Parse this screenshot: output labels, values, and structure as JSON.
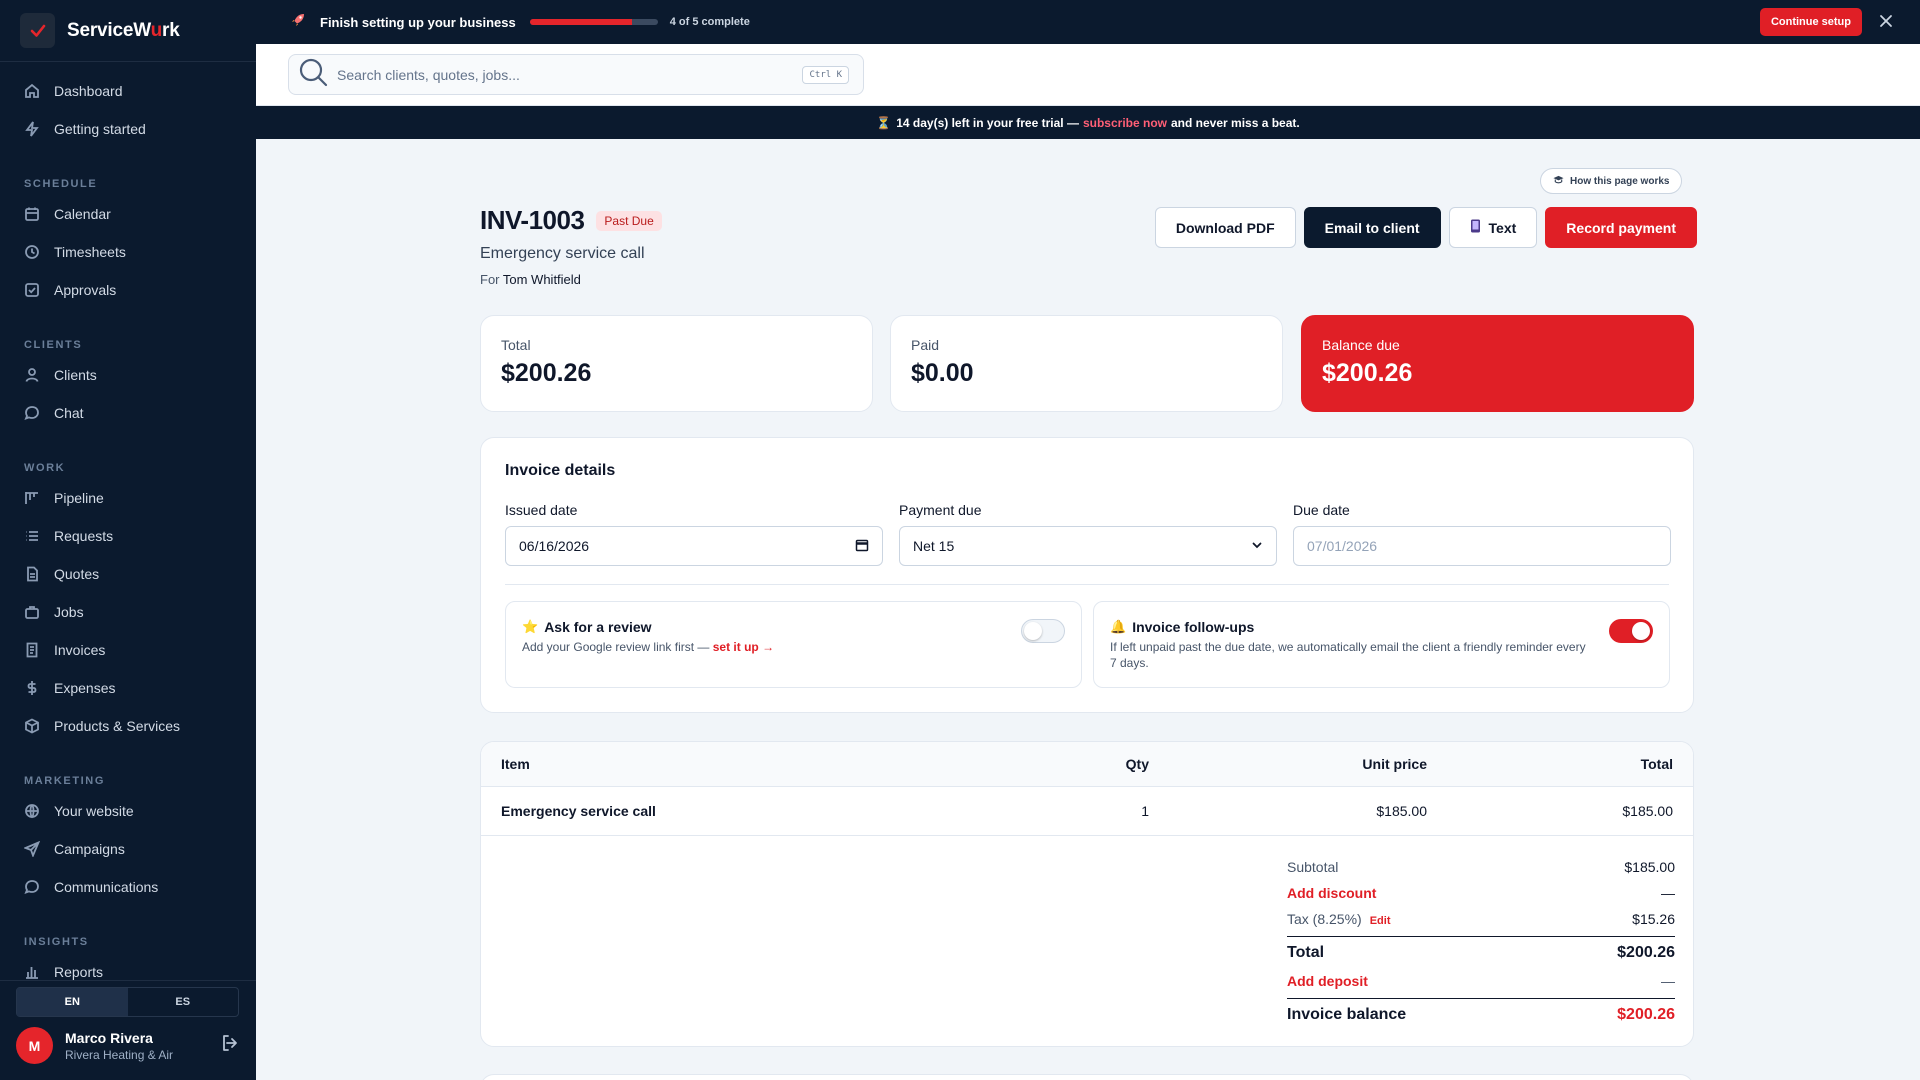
{
  "brand": {
    "prefix": "ServiceW",
    "accent": "u",
    "suffix": "rk"
  },
  "nav": {
    "top": [
      {
        "label": "Dashboard",
        "icon": "home-icon"
      },
      {
        "label": "Getting started",
        "icon": "bolt-icon"
      }
    ],
    "sections": [
      {
        "title": "SCHEDULE",
        "items": [
          {
            "label": "Calendar",
            "icon": "calendar-icon"
          },
          {
            "label": "Timesheets",
            "icon": "clock-icon"
          },
          {
            "label": "Approvals",
            "icon": "check-square-icon"
          }
        ]
      },
      {
        "title": "CLIENTS",
        "items": [
          {
            "label": "Clients",
            "icon": "user-icon"
          },
          {
            "label": "Chat",
            "icon": "chat-icon"
          }
        ]
      },
      {
        "title": "WORK",
        "items": [
          {
            "label": "Pipeline",
            "icon": "kanban-icon"
          },
          {
            "label": "Requests",
            "icon": "list-icon"
          },
          {
            "label": "Quotes",
            "icon": "file-icon"
          },
          {
            "label": "Jobs",
            "icon": "briefcase-icon"
          },
          {
            "label": "Invoices",
            "icon": "invoice-icon"
          },
          {
            "label": "Expenses",
            "icon": "dollar-icon"
          },
          {
            "label": "Products & Services",
            "icon": "box-icon"
          }
        ]
      },
      {
        "title": "MARKETING",
        "items": [
          {
            "label": "Your website",
            "icon": "globe-icon"
          },
          {
            "label": "Campaigns",
            "icon": "send-icon"
          },
          {
            "label": "Communications",
            "icon": "message-icon"
          }
        ]
      },
      {
        "title": "INSIGHTS",
        "items": [
          {
            "label": "Reports",
            "icon": "bar-chart-icon"
          }
        ]
      }
    ]
  },
  "lang": {
    "en": "EN",
    "es": "ES"
  },
  "user": {
    "initial": "M",
    "name": "Marco Rivera",
    "company": "Rivera Heating & Air"
  },
  "setup": {
    "title": "Finish setting up your business",
    "progress": 0.8,
    "count": "4 of 5 complete",
    "cta": "Continue setup"
  },
  "search": {
    "placeholder": "Search clients, quotes, jobs...",
    "shortcut": "Ctrl K"
  },
  "trial": {
    "days": "14",
    "text1": "day(s) left in your free trial —",
    "link": "subscribe now",
    "text2": "and never miss a beat."
  },
  "help": {
    "label": "How this page works"
  },
  "invoice": {
    "number": "INV-1003",
    "status": "Past Due",
    "subject": "Emergency service call",
    "for_label": "For",
    "client": "Tom Whitfield"
  },
  "actions": {
    "download": "Download PDF",
    "email": "Email to client",
    "text": "Text",
    "record": "Record payment"
  },
  "stats": {
    "total": {
      "label": "Total",
      "value": "$200.26"
    },
    "paid": {
      "label": "Paid",
      "value": "$0.00"
    },
    "balance": {
      "label": "Balance due",
      "value": "$200.26"
    }
  },
  "details": {
    "title": "Invoice details",
    "issued": {
      "label": "Issued date",
      "value": "06/16/2026"
    },
    "payment": {
      "label": "Payment due",
      "value": "Net 15"
    },
    "due": {
      "label": "Due date",
      "value": "07/01/2026"
    },
    "review": {
      "title": "Ask for a review",
      "desc": "Add your Google review link first —",
      "link": "set it up →",
      "enabled": false
    },
    "followups": {
      "title": "Invoice follow-ups",
      "desc": "If left unpaid past the due date, we automatically email the client a friendly reminder every 7 days.",
      "enabled": true
    }
  },
  "table": {
    "headers": {
      "item": "Item",
      "qty": "Qty",
      "unit": "Unit price",
      "total": "Total"
    },
    "rows": [
      {
        "item": "Emergency service call",
        "qty": "1",
        "unit": "$185.00",
        "total": "$185.00"
      }
    ]
  },
  "totals": {
    "subtotal": {
      "label": "Subtotal",
      "value": "$185.00"
    },
    "discount": {
      "label": "Add discount",
      "value": "—"
    },
    "tax": {
      "label": "Tax (8.25%)",
      "edit": "Edit",
      "value": "$15.26"
    },
    "total": {
      "label": "Total",
      "value": "$200.26"
    },
    "deposit": {
      "label": "Add deposit",
      "value": "—"
    },
    "balance": {
      "label": "Invoice balance",
      "value": "$200.26"
    }
  },
  "colors": {
    "navy": "#0b1a2e",
    "red": "#e01f26",
    "bg": "#f1f5f9"
  }
}
